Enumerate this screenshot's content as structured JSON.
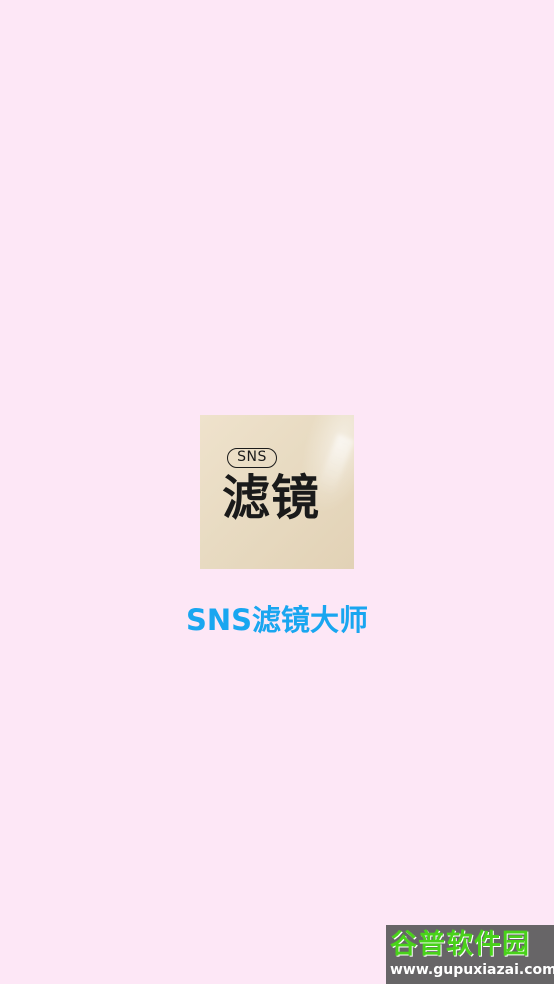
{
  "app": {
    "name": "SNS滤镜大师"
  },
  "icon": {
    "badge_text": "SNS",
    "title": "滤镜"
  },
  "watermark": {
    "title": "谷普软件园",
    "url": "www.gupuxiazai.com"
  },
  "colors": {
    "background": "#fde7f6",
    "app_name": "#19a6f0",
    "icon_bg": "#e8dbc2",
    "watermark_green": "#49d21a"
  }
}
